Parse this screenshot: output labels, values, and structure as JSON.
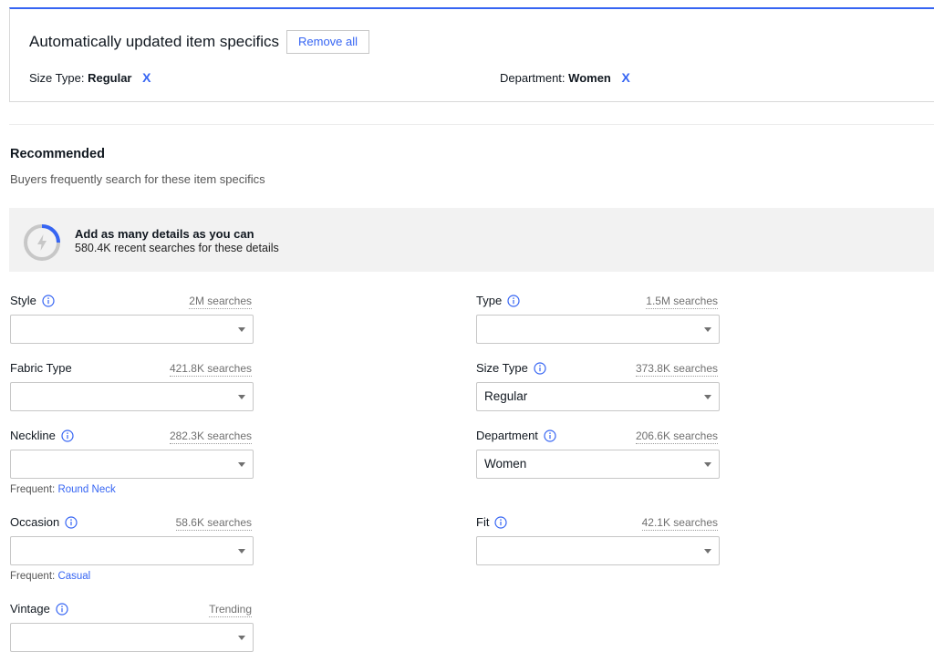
{
  "auto_updated": {
    "title": "Automatically updated item specifics",
    "remove_all": "Remove all",
    "chips": [
      {
        "label": "Size Type:",
        "value": "Regular"
      },
      {
        "label": "Department:",
        "value": "Women"
      }
    ],
    "remove_glyph": "X"
  },
  "recommended": {
    "title": "Recommended",
    "subtitle": "Buyers frequently search for these item specifics"
  },
  "tip": {
    "title": "Add as many details as you can",
    "subtitle": "580.4K recent searches for these details",
    "icon": "lightning-progress-icon"
  },
  "fields": [
    {
      "id": "style",
      "label": "Style",
      "searches": "2M searches",
      "value": ""
    },
    {
      "id": "type",
      "label": "Type",
      "searches": "1.5M searches",
      "value": ""
    },
    {
      "id": "fabric-type",
      "label": "Fabric Type",
      "searches": "421.8K searches",
      "value": ""
    },
    {
      "id": "size-type",
      "label": "Size Type",
      "searches": "373.8K searches",
      "value": "Regular"
    },
    {
      "id": "neckline",
      "label": "Neckline",
      "searches": "282.3K searches",
      "value": "",
      "frequent_label": "Frequent:",
      "frequent_value": "Round Neck"
    },
    {
      "id": "department",
      "label": "Department",
      "searches": "206.6K searches",
      "value": "Women"
    },
    {
      "id": "occasion",
      "label": "Occasion",
      "searches": "58.6K searches",
      "value": "",
      "frequent_label": "Frequent:",
      "frequent_value": "Casual"
    },
    {
      "id": "fit",
      "label": "Fit",
      "searches": "42.1K searches",
      "value": ""
    },
    {
      "id": "vintage",
      "label": "Vintage",
      "searches": "Trending",
      "value": ""
    }
  ],
  "colors": {
    "accent": "#3665f3",
    "text": "#111820",
    "muted": "#707070"
  }
}
